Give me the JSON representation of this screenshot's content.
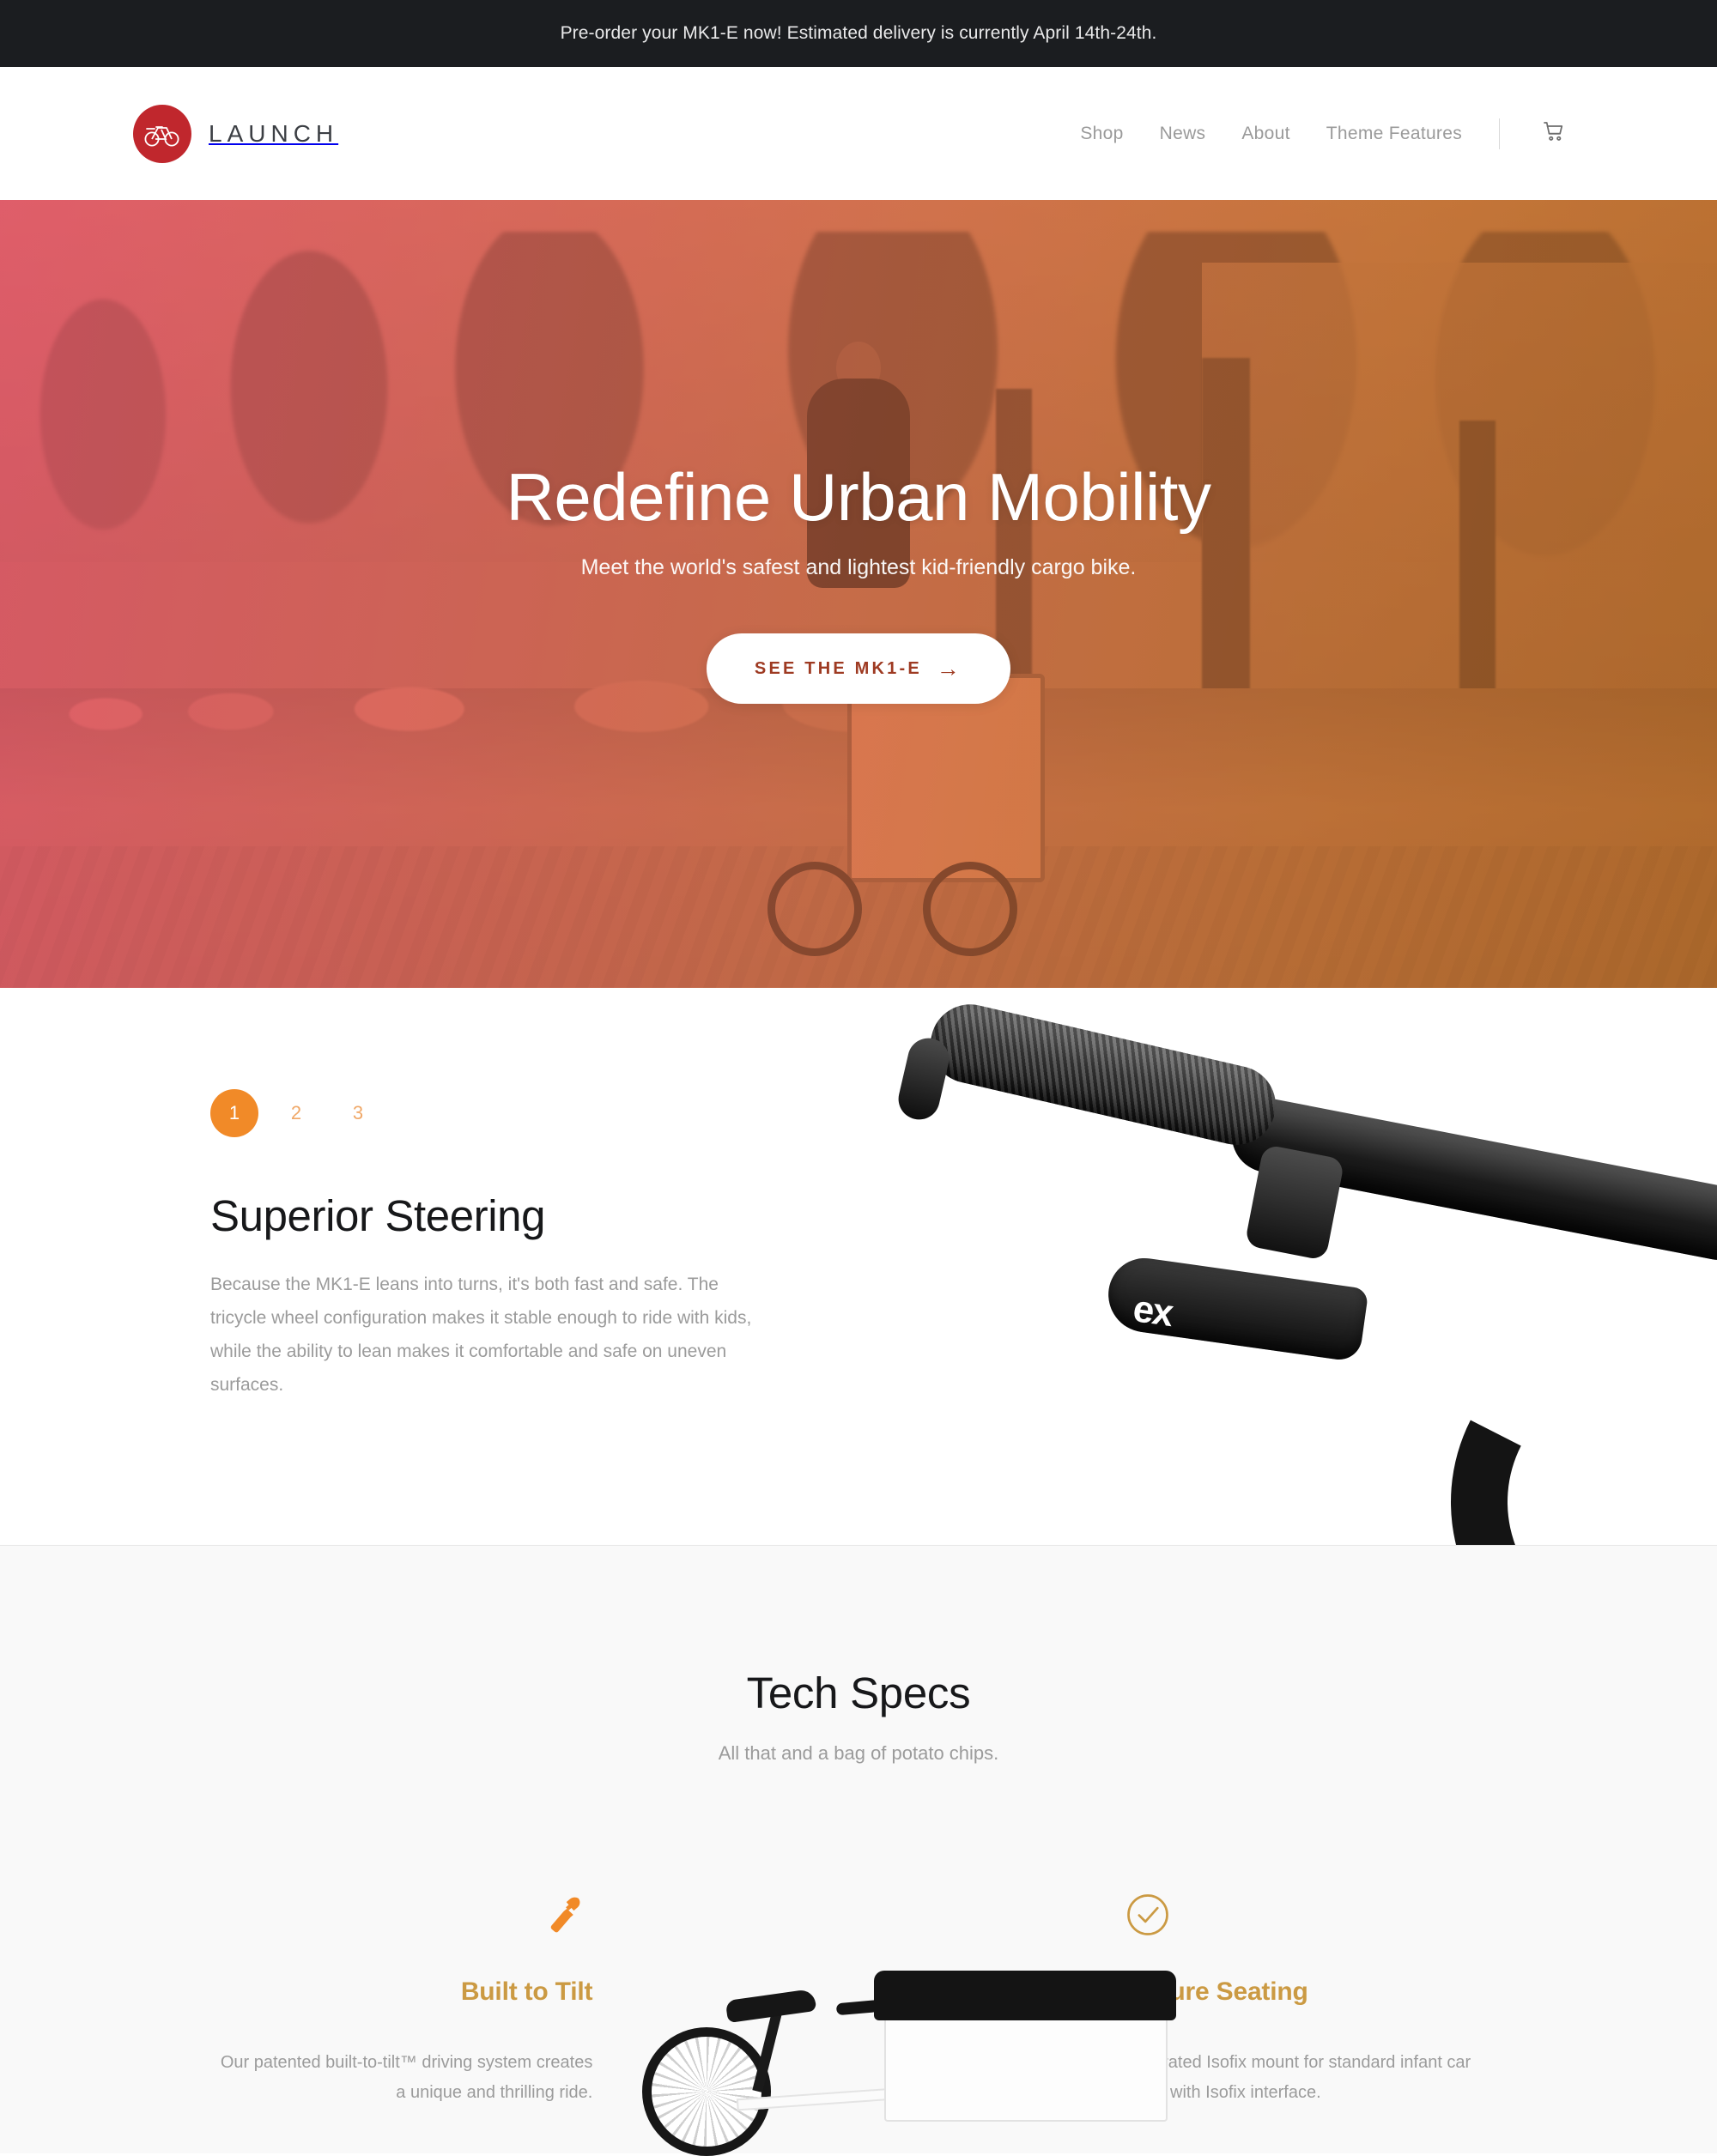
{
  "announcement": {
    "text": "Pre-order your MK1-E now! Estimated delivery is currently April 14th-24th.",
    "background": "#1b1d20"
  },
  "header": {
    "brand_name": "LAUNCH",
    "brand_mark_icon": "bicycle-in-circle-icon",
    "brand_mark_color": "#c0272d",
    "nav": [
      {
        "label": "Shop"
      },
      {
        "label": "News"
      },
      {
        "label": "About"
      },
      {
        "label": "Theme Features"
      }
    ],
    "cart_icon": "shopping-cart-icon"
  },
  "hero": {
    "title": "Redefine Urban Mobility",
    "subtitle": "Meet the world's safest and lightest kid-friendly cargo bike.",
    "cta_label": "SEE THE MK1-E",
    "cta_arrow": "→",
    "gradient_from": "#f4616f",
    "gradient_to": "#c9762c",
    "image_description": "Man riding a white cargo tricycle with two children in the box down a tree-lined city street"
  },
  "feature": {
    "tabs": [
      {
        "label": "1",
        "active": true
      },
      {
        "label": "2",
        "active": false
      },
      {
        "label": "3",
        "active": false
      }
    ],
    "active_color": "#f18a28",
    "title": "Superior Steering",
    "body": "Because the MK1-E leans into turns, it's both fast and safe. The tricycle wheel configuration makes it stable enough to ride with kids, while the ability to lean makes it comfortable and safe on uneven surfaces.",
    "image_description": "Close-up of a black bicycle handlebar grip and brake lever",
    "lever_text": "ex"
  },
  "specs": {
    "title": "Tech Specs",
    "subtitle": "All that and a bag of potato chips.",
    "background": "#f9f9f9",
    "heading_color": "#cb9a43",
    "items": [
      {
        "icon": "hammer-icon",
        "icon_color": "#f18a28",
        "name": "Built to Tilt",
        "description": "Our patented built-to-tilt™ driving system creates a unique and thrilling ride."
      },
      {
        "icon": "check-circle-icon",
        "icon_color": "#cb9a43",
        "name": "Secure Seating",
        "description": "Integrated Isofix mount for standard infant car seats with Isofix interface."
      }
    ],
    "center_image_description": "White cargo bike with black-topped cargo box"
  }
}
